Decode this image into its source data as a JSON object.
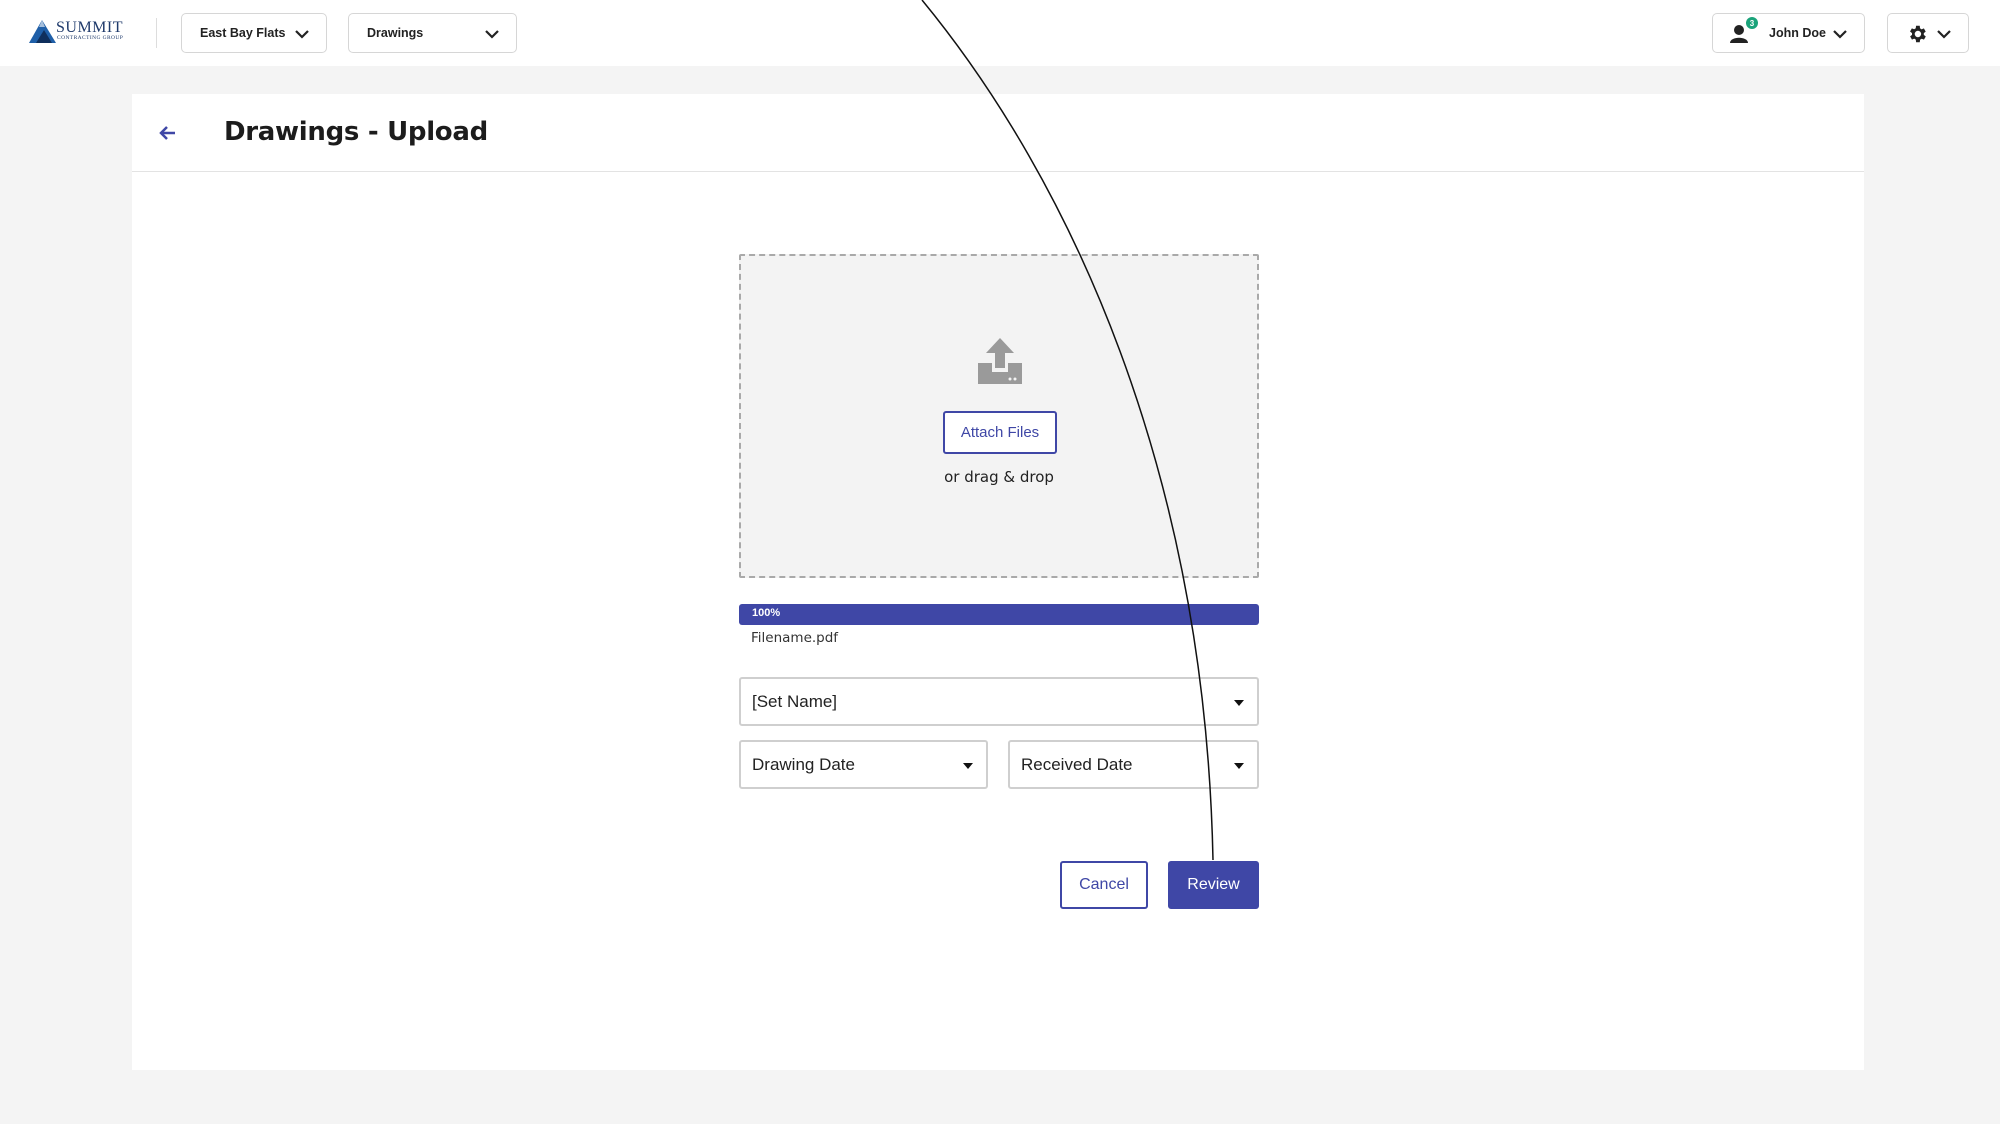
{
  "brand": {
    "name": "SUMMIT",
    "tagline": "CONTRACTING GROUP"
  },
  "header": {
    "project_selector": "East Bay Flats",
    "module_selector": "Drawings",
    "user": {
      "name": "John Doe",
      "notification_count": "3"
    },
    "settings_icon": "gear-icon"
  },
  "page": {
    "title": "Drawings - Upload",
    "back_icon": "arrow-left-icon"
  },
  "upload": {
    "icon": "upload-icon",
    "attach_label": "Attach Files",
    "drag_text": "or drag & drop"
  },
  "file": {
    "progress_percent": 100,
    "progress_label": "100%",
    "name": "Filename.pdf"
  },
  "form": {
    "set_name": "[Set Name]",
    "drawing_date": "Drawing Date",
    "received_date": "Received Date"
  },
  "actions": {
    "cancel": "Cancel",
    "review": "Review"
  },
  "colors": {
    "accent": "#3f47a6",
    "badge": "#1aa37a",
    "background": "#f4f4f4"
  }
}
